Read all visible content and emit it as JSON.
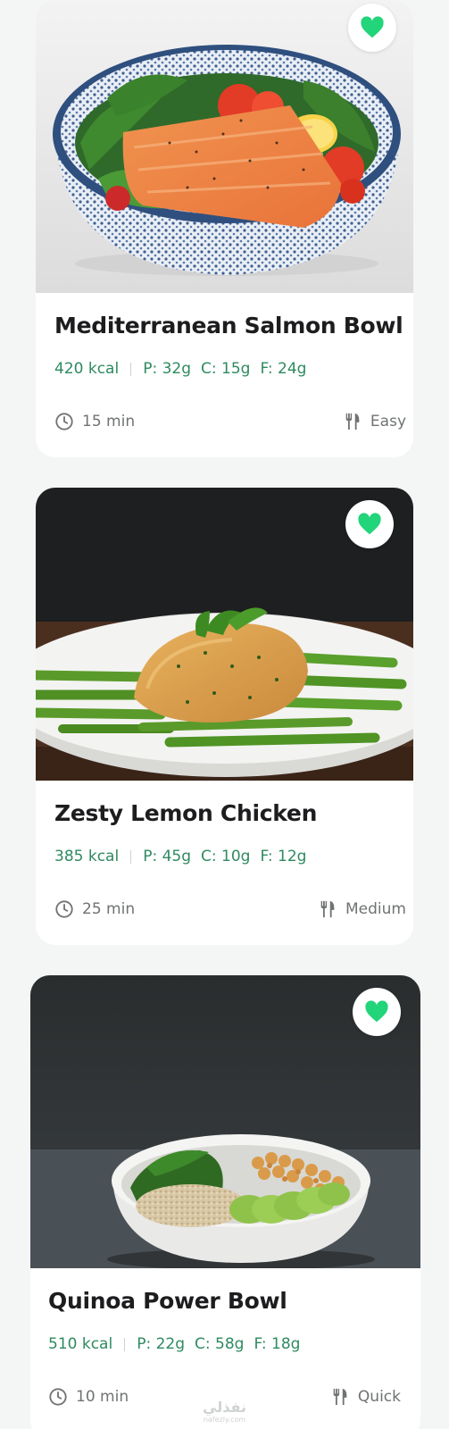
{
  "recipes": [
    {
      "title": "Mediterranean Salmon Bowl",
      "kcal": "420 kcal",
      "protein": "P: 32g",
      "carbs": "C: 15g",
      "fat": "F: 24g",
      "time": "15 min",
      "difficulty": "Easy",
      "favorite": true,
      "image": "salmon-bowl-photo"
    },
    {
      "title": "Zesty Lemon Chicken",
      "kcal": "385 kcal",
      "protein": "P: 45g",
      "carbs": "C: 10g",
      "fat": "F: 12g",
      "time": "25 min",
      "difficulty": "Medium",
      "favorite": true,
      "image": "lemon-chicken-photo"
    },
    {
      "title": "Quinoa Power Bowl",
      "kcal": "510 kcal",
      "protein": "P: 22g",
      "carbs": "C: 58g",
      "fat": "F: 18g",
      "time": "10 min",
      "difficulty": "Quick",
      "favorite": true,
      "image": "quinoa-bowl-photo"
    }
  ],
  "watermark": {
    "text": "نفذلي",
    "sub": "nafezly.com"
  },
  "colors": {
    "accent": "#2e8a60",
    "heart": "#22d47a",
    "background": "#f4f6f5"
  },
  "icons": {
    "favorite": "heart-icon",
    "time": "clock-icon",
    "difficulty": "utensils-icon"
  }
}
